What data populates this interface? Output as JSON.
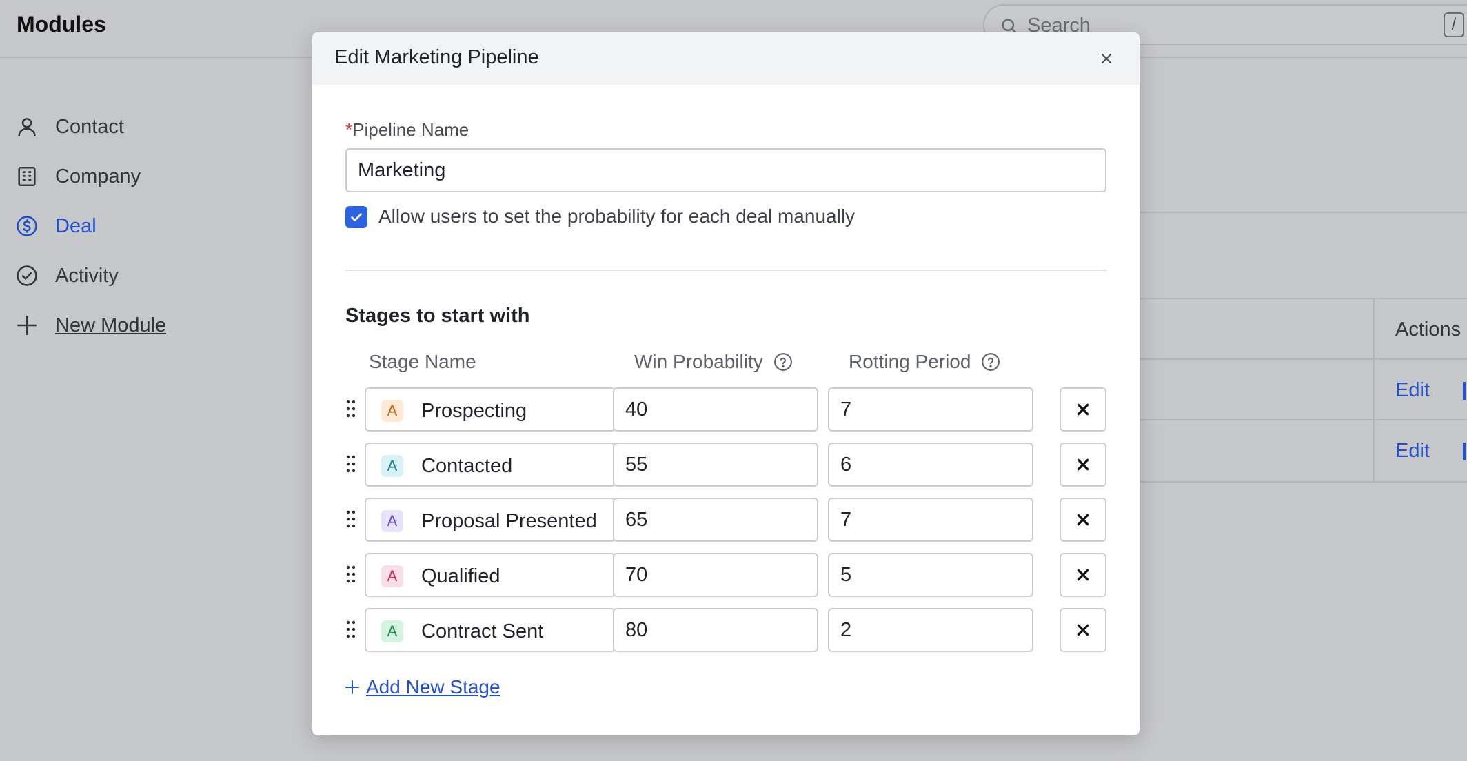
{
  "app": {
    "title": "Modules",
    "search": {
      "placeholder": "Search",
      "shortcut": "/"
    }
  },
  "sidebar": {
    "items": [
      {
        "label": "Contact",
        "icon": "person-icon"
      },
      {
        "label": "Company",
        "icon": "building-icon"
      },
      {
        "label": "Deal",
        "icon": "dollar-circle-icon",
        "active": true
      },
      {
        "label": "Activity",
        "icon": "check-circle-icon"
      },
      {
        "label": "New Module",
        "icon": "plus-icon"
      }
    ]
  },
  "background_table": {
    "actions_header": "Actions",
    "row_actions": [
      "Edit",
      "Edit"
    ]
  },
  "modal": {
    "title": "Edit Marketing Pipeline",
    "pipeline_name_label": "Pipeline Name",
    "required_marker": "*",
    "pipeline_name_value": "Marketing",
    "manual_probability_label": "Allow users to set the probability for each deal manually",
    "manual_probability_checked": true,
    "stages_title": "Stages to start with",
    "columns": {
      "stage_name": "Stage Name",
      "win_probability": "Win Probability",
      "rotting_period": "Rotting Period"
    },
    "stages": [
      {
        "avatar": "A",
        "name": "Prospecting",
        "win_probability": "40",
        "rotting_period": "7",
        "avatar_bg": "#fde9d4",
        "avatar_fg": "#c0641e"
      },
      {
        "avatar": "A",
        "name": "Contacted",
        "win_probability": "55",
        "rotting_period": "6",
        "avatar_bg": "#d7f1f7",
        "avatar_fg": "#1b7e93"
      },
      {
        "avatar": "A",
        "name": "Proposal Presented",
        "win_probability": "65",
        "rotting_period": "7",
        "avatar_bg": "#e8e1fa",
        "avatar_fg": "#6a45c9"
      },
      {
        "avatar": "A",
        "name": "Qualified",
        "win_probability": "70",
        "rotting_period": "5",
        "avatar_bg": "#fbdde6",
        "avatar_fg": "#c22e5d"
      },
      {
        "avatar": "A",
        "name": "Contract Sent",
        "win_probability": "80",
        "rotting_period": "2",
        "avatar_bg": "#d5f3e1",
        "avatar_fg": "#1c8a4c"
      }
    ],
    "add_stage_label": "Add New Stage"
  }
}
